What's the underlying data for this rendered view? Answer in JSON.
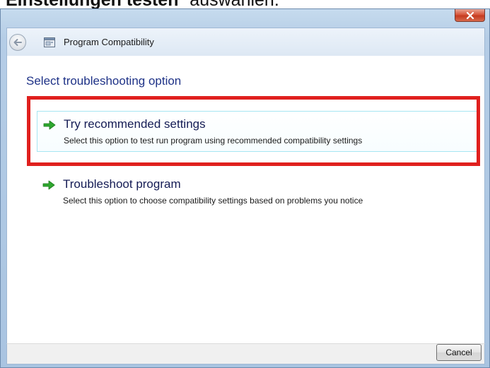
{
  "caption": {
    "bold_text": "Einstellungen testen",
    "rest_text": "\" auswählen."
  },
  "window": {
    "title": "Program Compatibility",
    "close_icon": "close-icon",
    "back_icon": "back-arrow-icon",
    "app_icon": "program-compatibility-icon"
  },
  "content": {
    "heading": "Select troubleshooting option",
    "options": [
      {
        "title": "Try recommended settings",
        "description": "Select this option to test run program using recommended compatibility settings",
        "icon": "green-arrow-icon",
        "selected": true
      },
      {
        "title": "Troubleshoot program",
        "description": "Select this option to choose compatibility settings based on problems you notice",
        "icon": "green-arrow-icon",
        "selected": false
      }
    ]
  },
  "footer": {
    "cancel_label": "Cancel"
  },
  "colors": {
    "highlight": "#e0201e",
    "heading": "#1e3287",
    "arrow": "#2fa82f",
    "frame": "#b5cde6"
  }
}
